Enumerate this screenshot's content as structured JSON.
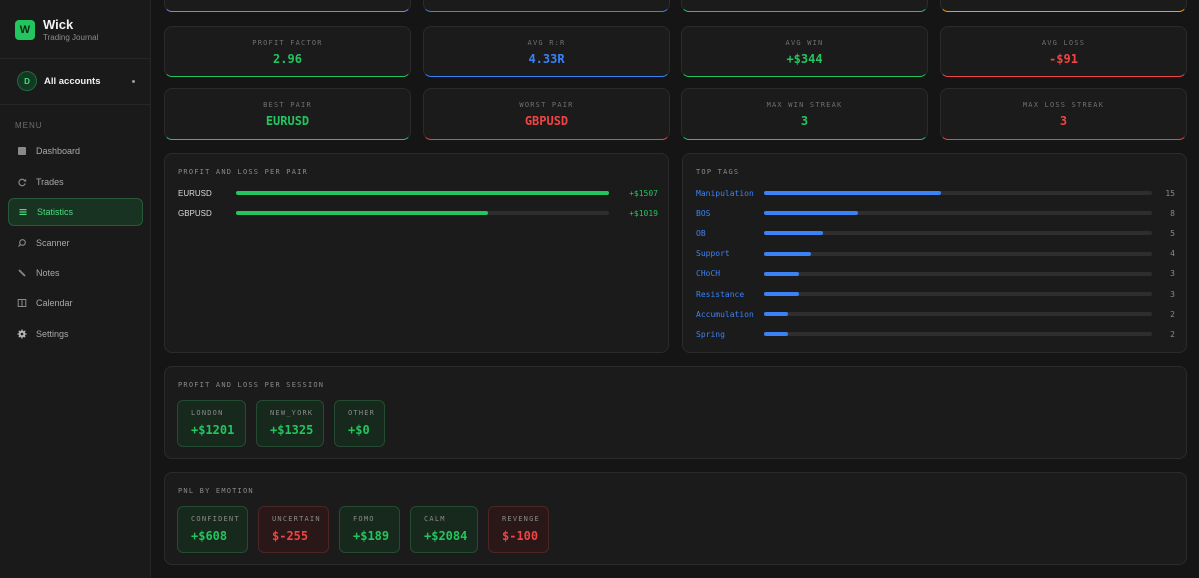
{
  "brand": {
    "logo": "W",
    "name": "Wick",
    "subtitle": "Trading Journal"
  },
  "account": {
    "avatar": "D",
    "label": "All accounts"
  },
  "menu": {
    "title": "MENU",
    "items": [
      {
        "label": "Dashboard",
        "icon": "dashboard-icon"
      },
      {
        "label": "Trades",
        "icon": "trades-icon"
      },
      {
        "label": "Statistics",
        "icon": "statistics-icon",
        "active": true
      },
      {
        "label": "Scanner",
        "icon": "scanner-icon"
      },
      {
        "label": "Notes",
        "icon": "notes-icon"
      },
      {
        "label": "Calendar",
        "icon": "calendar-icon"
      },
      {
        "label": "Settings",
        "icon": "gear-icon"
      }
    ]
  },
  "stats_row1": [
    {
      "label": "PROFIT FACTOR",
      "value": "2.96",
      "color": "green"
    },
    {
      "label": "AVG R:R",
      "value": "4.33R",
      "color": "blue"
    },
    {
      "label": "AVG WIN",
      "value": "+$344",
      "color": "green"
    },
    {
      "label": "AVG LOSS",
      "value": "-$91",
      "color": "red"
    }
  ],
  "stats_row2": [
    {
      "label": "BEST PAIR",
      "value": "EURUSD",
      "color": "green"
    },
    {
      "label": "WORST PAIR",
      "value": "GBPUSD",
      "color": "red"
    },
    {
      "label": "MAX WIN STREAK",
      "value": "3",
      "color": "green"
    },
    {
      "label": "MAX LOSS STREAK",
      "value": "3",
      "color": "red"
    }
  ],
  "pnl_per_pair": {
    "title": "PROFIT AND LOSS PER PAIR",
    "rows": [
      {
        "pair": "EURUSD",
        "value": "+$1507",
        "amount": 1507
      },
      {
        "pair": "GBPUSD",
        "value": "+$1019",
        "amount": 1019
      }
    ]
  },
  "top_tags": {
    "title": "TOP TAGS",
    "rows": [
      {
        "tag": "Manipulation",
        "count": 15
      },
      {
        "tag": "BOS",
        "count": 8
      },
      {
        "tag": "OB",
        "count": 5
      },
      {
        "tag": "Support",
        "count": 4
      },
      {
        "tag": "CHoCH",
        "count": 3
      },
      {
        "tag": "Resistance",
        "count": 3
      },
      {
        "tag": "Accumulation",
        "count": 2
      },
      {
        "tag": "Spring",
        "count": 2
      }
    ]
  },
  "pnl_per_session": {
    "title": "PROFIT AND LOSS PER SESSION",
    "items": [
      {
        "label": "LONDON",
        "value": "+$1201"
      },
      {
        "label": "NEW_YORK",
        "value": "+$1325"
      },
      {
        "label": "OTHER",
        "value": "+$0"
      }
    ]
  },
  "pnl_by_emotion": {
    "title": "PNL BY EMOTION",
    "items": [
      {
        "label": "CONFIDENT",
        "value": "+$608",
        "tone": "pos"
      },
      {
        "label": "UNCERTAIN",
        "value": "$-255",
        "tone": "neg"
      },
      {
        "label": "FOMO",
        "value": "+$189",
        "tone": "pos"
      },
      {
        "label": "CALM",
        "value": "+$2084",
        "tone": "pos"
      },
      {
        "label": "REVENGE",
        "value": "$-100",
        "tone": "neg"
      }
    ]
  },
  "colors": {
    "green": "#22c55e",
    "blue": "#3b82f6",
    "red": "#ef4444"
  }
}
